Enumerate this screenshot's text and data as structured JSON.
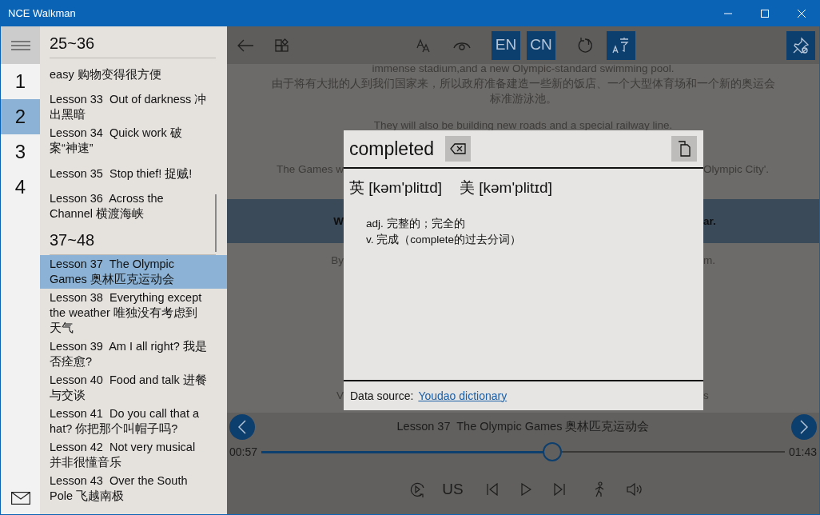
{
  "window": {
    "title": "NCE Walkman"
  },
  "rail": {
    "items": [
      {
        "label": "1",
        "selected": false
      },
      {
        "label": "2",
        "selected": true
      },
      {
        "label": "3",
        "selected": false
      },
      {
        "label": "4",
        "selected": false
      }
    ]
  },
  "sidebar": {
    "groups": [
      {
        "heading": "25~36",
        "lessons": [
          {
            "title": "easy 购物变得很方便",
            "selected": false
          },
          {
            "title": "Lesson 33  Out of darkness 冲出黑暗",
            "selected": false
          },
          {
            "title": "Lesson 34  Quick work 破案“神速”",
            "selected": false
          },
          {
            "title": "Lesson 35  Stop thief! 捉贼!",
            "selected": false
          },
          {
            "title": "Lesson 36  Across the Channel 横渡海峡",
            "selected": false
          }
        ]
      },
      {
        "heading": "37~48",
        "lessons": [
          {
            "title": "Lesson 37  The Olympic Games 奥林匹克运动会",
            "selected": true
          },
          {
            "title": "Lesson 38  Everything except the weather 唯独没有考虑到天气",
            "selected": false
          },
          {
            "title": "Lesson 39  Am I all right? 我是否痊愈?",
            "selected": false
          },
          {
            "title": "Lesson 40  Food and talk 进餐与交谈",
            "selected": false
          },
          {
            "title": "Lesson 41  Do you call that a hat? 你把那个叫帽子吗?",
            "selected": false
          },
          {
            "title": "Lesson 42  Not very musical 并非很懂音乐",
            "selected": false
          },
          {
            "title": "Lesson 43  Over the South Pole 飞越南极",
            "selected": false
          }
        ]
      }
    ]
  },
  "toolbar": [
    {
      "kind": "back",
      "active": false
    },
    {
      "kind": "layout",
      "active": false
    },
    {
      "kind": "font-size",
      "active": false
    },
    {
      "kind": "eye",
      "active": false
    },
    {
      "kind": "text",
      "label": "EN",
      "active": true
    },
    {
      "kind": "text",
      "label": "CN",
      "active": true
    },
    {
      "kind": "replay",
      "active": false
    },
    {
      "kind": "translate",
      "active": true
    },
    {
      "kind": "pin",
      "active": true
    }
  ],
  "passage": [
    {
      "text": "immense stadium,and a new Olympic-standard swimming pool.",
      "highlighted": false
    },
    {
      "text": "由于将有大批的人到我们国家来，所以政府准备建造一些新的饭店、一个大型体育场和一个新的奥运会标准游泳池。",
      "highlighted": false
    },
    {
      "text": "They will also be building new roads and a special railway line.",
      "highlighted": false
    },
    {
      "left": "The Games w",
      "right": "Olympic City'.",
      "highlighted": false
    },
    {
      "left": "W",
      "right": "ar.",
      "highlighted": true
    },
    {
      "left": "By",
      "right": "m.",
      "highlighted": false
    },
    {
      "left": "V",
      "right": "s",
      "highlighted": false
    }
  ],
  "dictionary": {
    "word": "completed",
    "phonetics": [
      {
        "label": "英",
        "ipa": "[kəm'plitɪd]"
      },
      {
        "label": "美",
        "ipa": "[kəm'plitɪd]"
      }
    ],
    "definitions": [
      "adj. 完整的；完全的",
      "v. 完成（complete的过去分词）"
    ],
    "source_label": "Data source:",
    "source_link": "Youdao dictionary"
  },
  "player": {
    "title": "Lesson 37  The Olympic Games 奥林匹克运动会",
    "elapsed": "00:57",
    "total": "01:43",
    "level": 0.555,
    "accent": "US"
  }
}
